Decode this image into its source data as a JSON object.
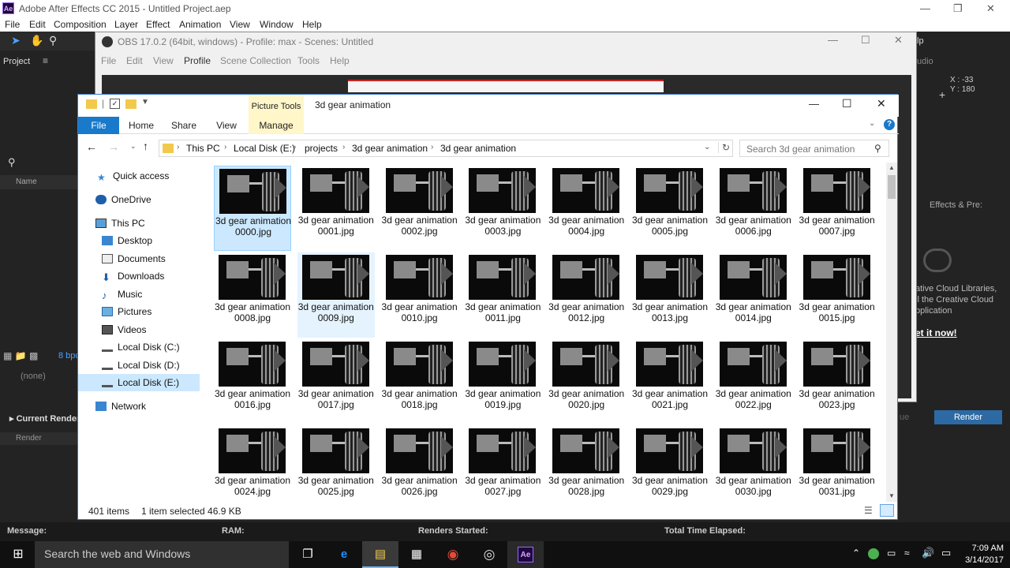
{
  "ae": {
    "title": "Adobe After Effects CC 2015 - Untitled Project.aep",
    "logo": "Ae",
    "menu": [
      "File",
      "Edit",
      "Composition",
      "Layer",
      "Effect",
      "Animation",
      "View",
      "Window",
      "Help"
    ],
    "project_label": "Project",
    "name_col": "Name",
    "bpc": "8 bpc",
    "none_label": "(none)",
    "current_render": "Current Render",
    "render_btn": "Render",
    "queue_label": "ue",
    "render_small": "Render",
    "coords_x": "X : -33",
    "coords_y": "Y : 180",
    "audio_label": "udio",
    "effects_presets": "Effects & Pre:",
    "cc_line1": "ative Cloud Libraries,",
    "cc_line2": "ll the Creative Cloud",
    "cc_line3": "pplication",
    "get_it": "et it now!",
    "right_help": "lp",
    "status": {
      "message": "Message:",
      "ram": "RAM:",
      "renders_started": "Renders Started:",
      "total_time": "Total Time Elapsed:"
    }
  },
  "obs": {
    "title": "OBS 17.0.2 (64bit, windows) - Profile: max - Scenes: Untitled",
    "menu": [
      "File",
      "Edit",
      "View",
      "Profile",
      "Scene Collection",
      "Tools",
      "Help"
    ]
  },
  "explorer": {
    "title": "3d gear animation",
    "picture_tools": "Picture Tools",
    "tabs": [
      "File",
      "Home",
      "Share",
      "View",
      "Manage"
    ],
    "breadcrumbs": [
      "This PC",
      "Local Disk (E:)",
      "projects",
      "3d gear animation",
      "3d gear animation"
    ],
    "search_placeholder": "Search 3d gear animation",
    "nav": [
      {
        "label": "Quick access",
        "icon": "star-icon"
      },
      {
        "label": "OneDrive",
        "icon": "cloud-icon"
      },
      {
        "label": "This PC",
        "icon": "computer-icon"
      },
      {
        "label": "Desktop",
        "icon": "desktop-icon"
      },
      {
        "label": "Documents",
        "icon": "documents-icon"
      },
      {
        "label": "Downloads",
        "icon": "download-icon"
      },
      {
        "label": "Music",
        "icon": "music-icon"
      },
      {
        "label": "Pictures",
        "icon": "pictures-icon"
      },
      {
        "label": "Videos",
        "icon": "videos-icon"
      },
      {
        "label": "Local Disk (C:)",
        "icon": "drive-icon"
      },
      {
        "label": "Local Disk (D:)",
        "icon": "drive-icon"
      },
      {
        "label": "Local Disk (E:)",
        "icon": "drive-icon"
      },
      {
        "label": "Network",
        "icon": "network-icon"
      }
    ],
    "files": [
      "3d gear animation0000.jpg",
      "3d gear animation0001.jpg",
      "3d gear animation0002.jpg",
      "3d gear animation0003.jpg",
      "3d gear animation0004.jpg",
      "3d gear animation0005.jpg",
      "3d gear animation0006.jpg",
      "3d gear animation0007.jpg",
      "3d gear animation0008.jpg",
      "3d gear animation0009.jpg",
      "3d gear animation0010.jpg",
      "3d gear animation0011.jpg",
      "3d gear animation0012.jpg",
      "3d gear animation0013.jpg",
      "3d gear animation0014.jpg",
      "3d gear animation0015.jpg",
      "3d gear animation0016.jpg",
      "3d gear animation0017.jpg",
      "3d gear animation0018.jpg",
      "3d gear animation0019.jpg",
      "3d gear animation0020.jpg",
      "3d gear animation0021.jpg",
      "3d gear animation0022.jpg",
      "3d gear animation0023.jpg",
      "3d gear animation0024.jpg",
      "3d gear animation0025.jpg",
      "3d gear animation0026.jpg",
      "3d gear animation0027.jpg",
      "3d gear animation0028.jpg",
      "3d gear animation0029.jpg",
      "3d gear animation0030.jpg",
      "3d gear animation0031.jpg"
    ],
    "item_count": "401 items",
    "selection": "1 item selected  46.9 KB"
  },
  "taskbar": {
    "search_placeholder": "Search the web and Windows",
    "time": "7:09 AM",
    "date": "3/14/2017"
  }
}
